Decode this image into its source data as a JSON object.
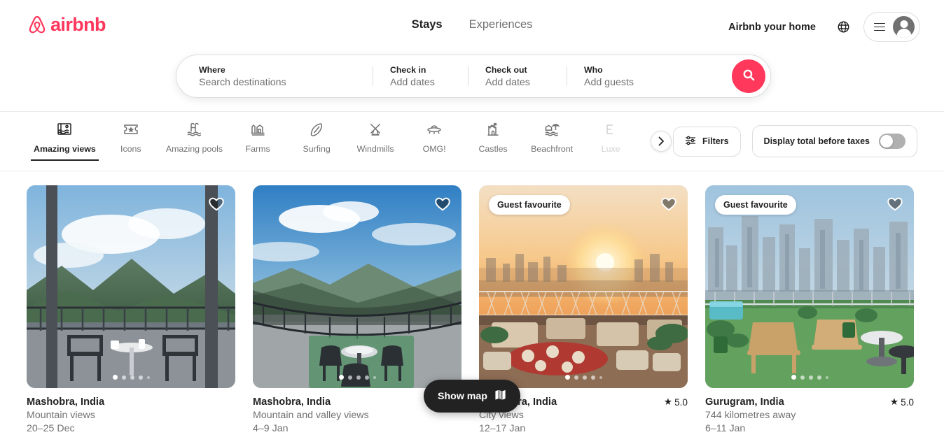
{
  "brand": {
    "name": "airbnb",
    "color": "#FF385C"
  },
  "header": {
    "tabs": [
      {
        "label": "Stays",
        "active": true
      },
      {
        "label": "Experiences",
        "active": false
      }
    ],
    "host_link": "Airbnb your home",
    "globe_icon": "globe-icon",
    "menu_icon": "hamburger-icon",
    "avatar_icon": "user-avatar-icon"
  },
  "search": {
    "where": {
      "label": "Where",
      "placeholder": "Search destinations",
      "value": ""
    },
    "checkin": {
      "label": "Check in",
      "value": "Add dates"
    },
    "checkout": {
      "label": "Check out",
      "value": "Add dates"
    },
    "who": {
      "label": "Who",
      "value": "Add guests"
    },
    "search_icon": "search-icon"
  },
  "categories": {
    "items": [
      {
        "label": "Amazing views",
        "icon": "amazing-views-icon",
        "active": true
      },
      {
        "label": "Icons",
        "icon": "ticket-star-icon",
        "active": false
      },
      {
        "label": "Amazing pools",
        "icon": "pool-icon",
        "active": false
      },
      {
        "label": "Farms",
        "icon": "farm-icon",
        "active": false
      },
      {
        "label": "Surfing",
        "icon": "surfboard-icon",
        "active": false
      },
      {
        "label": "Windmills",
        "icon": "windmill-icon",
        "active": false
      },
      {
        "label": "OMG!",
        "icon": "ufo-icon",
        "active": false
      },
      {
        "label": "Castles",
        "icon": "castle-icon",
        "active": false
      },
      {
        "label": "Beachfront",
        "icon": "beachfront-icon",
        "active": false
      },
      {
        "label": "Luxe",
        "icon": "luxe-icon",
        "active": false
      }
    ],
    "next_label": "›",
    "filters": {
      "label": "Filters",
      "icon": "filters-icon"
    },
    "taxes_toggle": {
      "label": "Display total before taxes",
      "on": false
    }
  },
  "listings": [
    {
      "title": "Mashobra, India",
      "subtitle": "Mountain views",
      "dates": "20–25 Dec",
      "rating": "",
      "badge": "",
      "dots": 5,
      "active_dot": 0
    },
    {
      "title": "Mashobra, India",
      "subtitle": "Mountain and valley views",
      "dates": "4–9 Jan",
      "rating": "",
      "badge": "",
      "dots": 5,
      "active_dot": 0
    },
    {
      "title": "Mashobra, India",
      "subtitle": "City views",
      "dates": "12–17 Jan",
      "rating": "5.0",
      "badge": "Guest favourite",
      "dots": 5,
      "active_dot": 0
    },
    {
      "title": "Gurugram, India",
      "subtitle": "744 kilometres away",
      "dates": "6–11 Jan",
      "rating": "5.0",
      "badge": "Guest favourite",
      "dots": 5,
      "active_dot": 0
    }
  ],
  "map_button": {
    "label": "Show map",
    "icon": "map-icon"
  },
  "star_glyph": "★"
}
